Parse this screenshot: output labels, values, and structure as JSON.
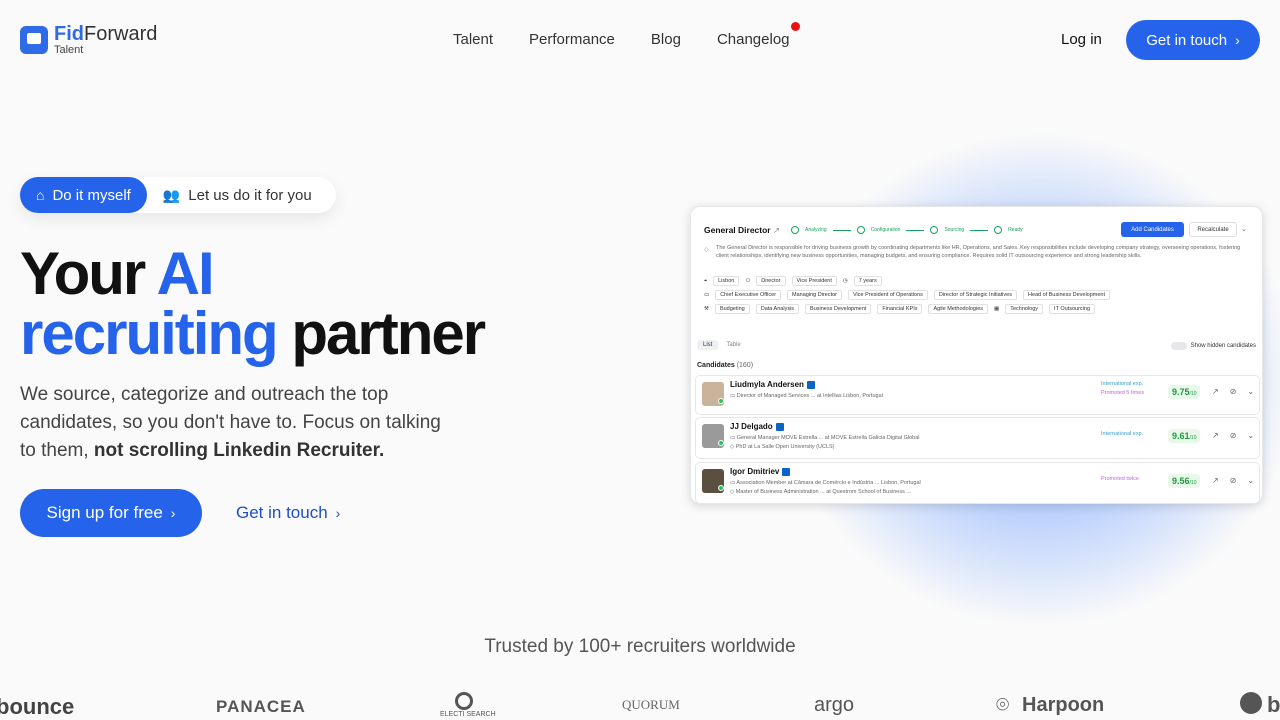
{
  "nav": {
    "brand_bold": "Fid",
    "brand_rest": "Forward",
    "brand_sub": "Talent",
    "links": [
      "Talent",
      "Performance",
      "Blog",
      "Changelog"
    ],
    "login": "Log in",
    "cta": "Get in touch"
  },
  "hero": {
    "toggle_active": "Do it myself",
    "toggle_inactive": "Let us do it for you",
    "title_1": "Your ",
    "title_2": "AI",
    "title_3": "recruiting",
    "title_4": " partner",
    "sub_1": "We source, categorize and outreach the top candidates, so you don't have to. Focus on talking to them, ",
    "sub_bold": "not scrolling Linkedin Recruiter.",
    "signup": "Sign up for free",
    "contact": "Get in touch"
  },
  "card": {
    "job_title": "General Director",
    "steps": [
      "Analyzing",
      "Configuration",
      "Sourcing",
      "Ready"
    ],
    "add_btn": "Add Candidates",
    "recalc_btn": "Recalculate",
    "description": "The General Director is responsible for driving business growth by coordinating departments like HR, Operations, and Sales. Key responsibilities include developing company strategy, overseeing operations, fostering client relationships, identifying new business opportunities, managing budgets, and ensuring compliance. Requires solid IT outsourcing experience and strong leadership skills.",
    "meta": [
      "Lisbon",
      "Director",
      "Vice President",
      "7 years"
    ],
    "titles": [
      "Chief Executive Officer",
      "Managing Director",
      "Vice President of Operations",
      "Director of Strategic Initiatives",
      "Head of Business Development"
    ],
    "skills": [
      "Budgeting",
      "Data Analysis",
      "Business Development",
      "Financial KPIs",
      "Agile Methodologies",
      "Technology",
      "IT Outsourcing"
    ],
    "tab_list": "List",
    "tab_table": "Table",
    "show_hidden": "Show hidden candidates",
    "candidates_label": "Candidates",
    "candidates_count": "(160)",
    "candidates": [
      {
        "name": "Liudmyla Andersen",
        "line1": "Director of Managed Services ... at Intellias  Lisbon, Portugal",
        "line2": "",
        "badge1": "International exp.",
        "badge2": "Promoted 5 times",
        "score": "9.75"
      },
      {
        "name": "JJ Delgado",
        "line1": "General Manager MOVE Estrella ... at MOVE Estrella Galicia Digital  Global",
        "line2": "PhD at La Salle Open University (UCLS)",
        "badge1": "International exp.",
        "badge2": "",
        "score": "9.61"
      },
      {
        "name": "Igor Dmitriev",
        "line1": "Association Member at Câmara de Comércio e Indústria ...  Lisbon, Portugal",
        "line2": "Master of Business Administration ... at Questrom School of Business ...",
        "badge1": "",
        "badge2": "Promoted twice",
        "score": "9.56"
      }
    ],
    "score_unit": "/10"
  },
  "trusted": "Trusted by 100+ recruiters worldwide",
  "logos": [
    "bounce",
    "PANACEA",
    "ELECTI SEARCH",
    "QUORUM",
    "argo",
    "Harpoon",
    "b"
  ],
  "colors": {
    "accent": "#2563eb",
    "score_bg": "#e8f8ea",
    "score_fg": "#1c9a3e"
  }
}
